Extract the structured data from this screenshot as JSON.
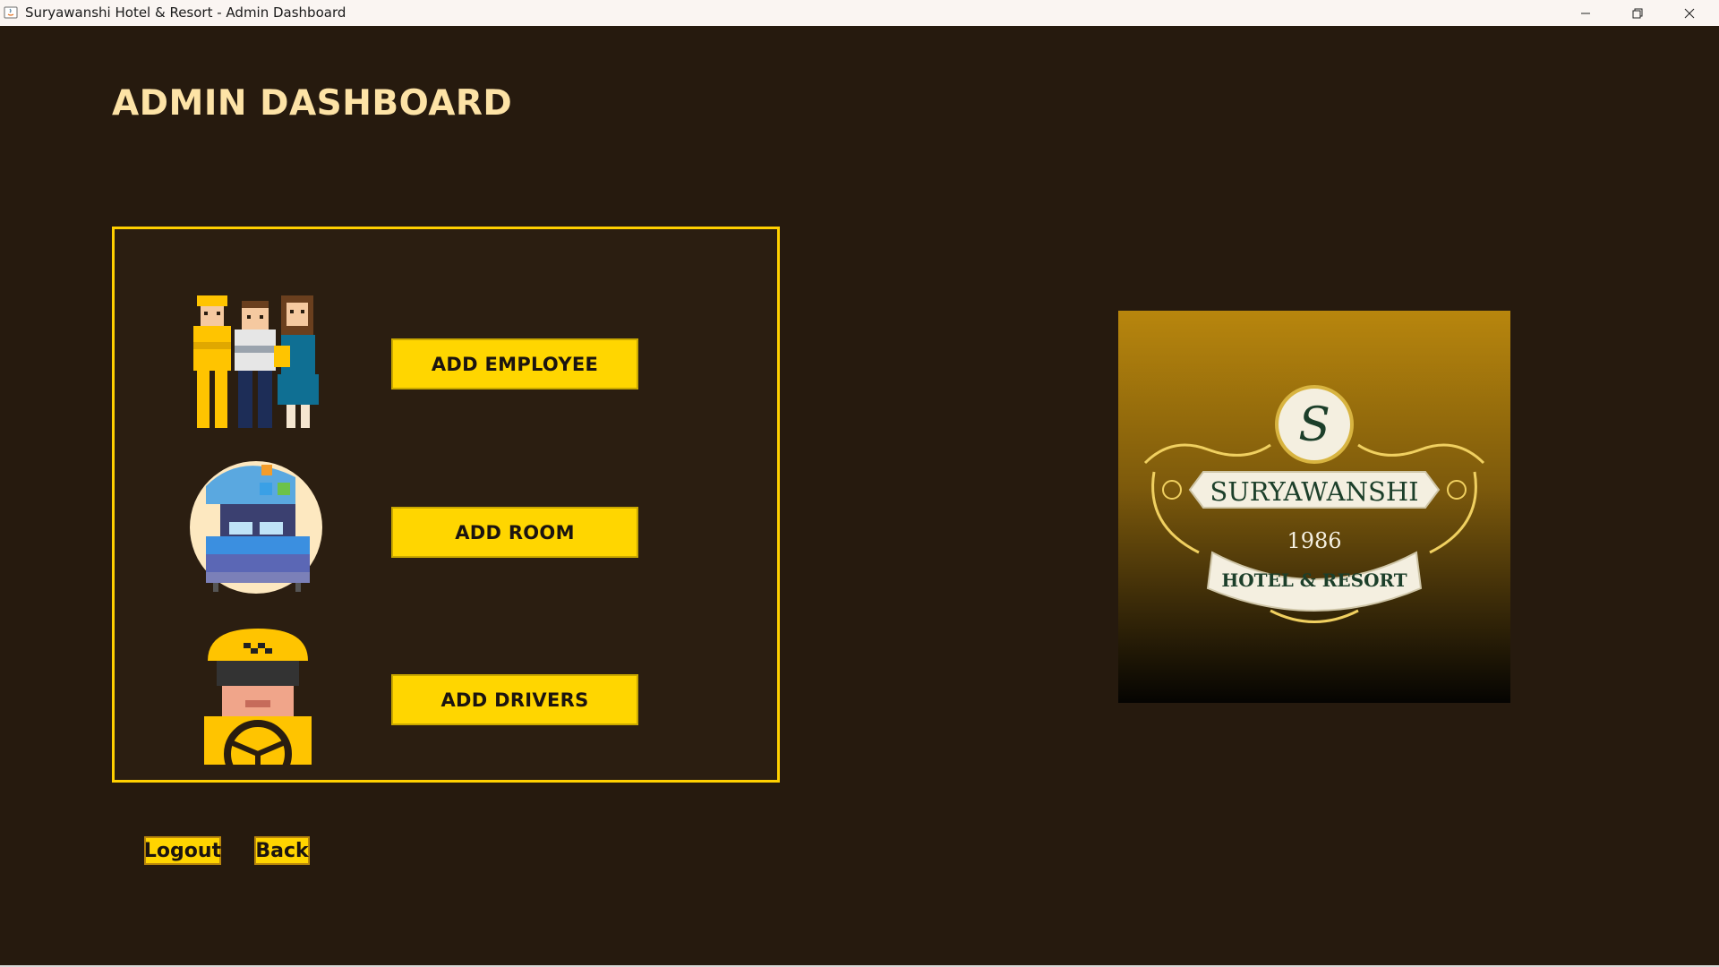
{
  "window": {
    "title": "Suryawanshi Hotel & Resort - Admin Dashboard"
  },
  "page": {
    "title": "ADMIN DASHBOARD"
  },
  "actions": {
    "add_employee": "ADD EMPLOYEE",
    "add_room": "ADD ROOM",
    "add_drivers": "ADD DRIVERS"
  },
  "footer": {
    "logout": "Logout",
    "back": "Back"
  },
  "logo": {
    "monogram": "S",
    "name": "SURYAWANSHI",
    "year": "1986",
    "tagline": "HOTEL & RESORT"
  },
  "colors": {
    "background": "#261a0e",
    "accent": "#ffd600",
    "title": "#fde3a6",
    "panel_border": "#ffd000"
  },
  "icons": {
    "employees": "employees-group-icon",
    "room": "bed-room-icon",
    "driver": "taxi-driver-icon"
  }
}
